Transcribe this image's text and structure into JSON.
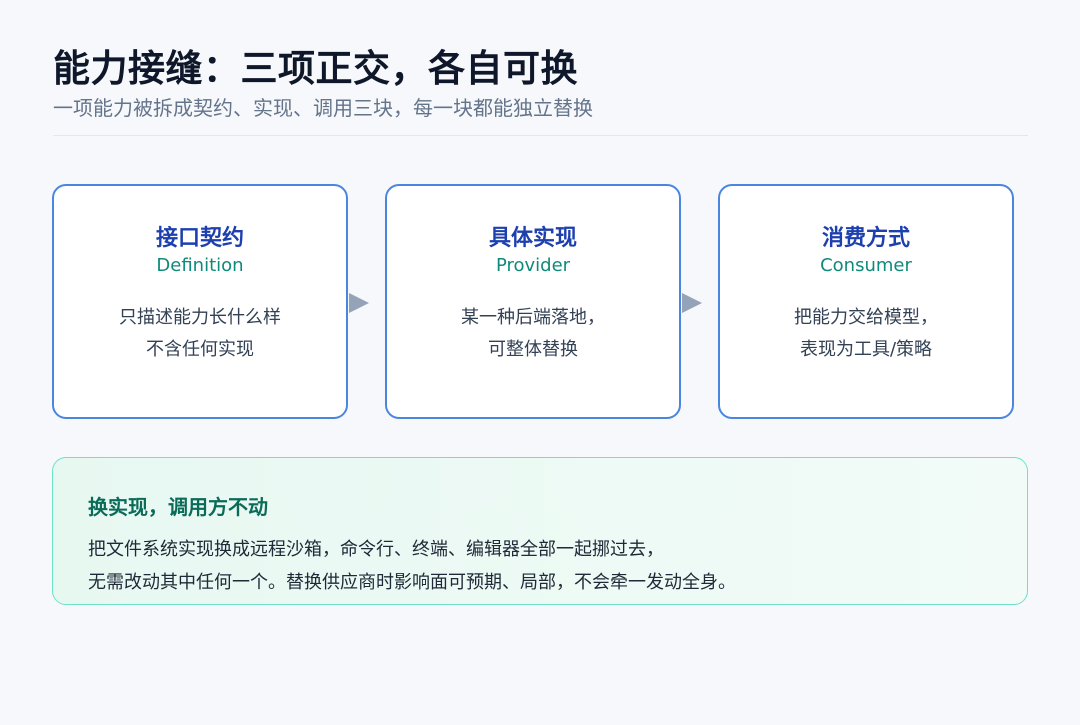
{
  "header": {
    "title": "能力接缝：三项正交，各自可换",
    "subtitle": "一项能力被拆成契约、实现、调用三块，每一块都能独立替换"
  },
  "cards": [
    {
      "title": "接口契约",
      "subtitle": "Definition",
      "lines": [
        "只描述能力长什么样",
        "不含任何实现"
      ]
    },
    {
      "title": "具体实现",
      "subtitle": "Provider",
      "lines": [
        "某一种后端落地，",
        "可整体替换"
      ]
    },
    {
      "title": "消费方式",
      "subtitle": "Consumer",
      "lines": [
        "把能力交给模型，",
        "表现为工具/策略"
      ]
    }
  ],
  "note": {
    "title": "换实现，调用方不动",
    "lines": [
      "把文件系统实现换成远程沙箱，命令行、终端、编辑器全部一起挪过去，",
      "无需改动其中任何一个。替换供应商时影响面可预期、局部，不会牵一发动全身。"
    ]
  },
  "colors": {
    "card_border": "#4a86e0",
    "card_title": "#1e40af",
    "card_subtitle": "#0f8a7a",
    "arrow": "#94a3b8",
    "note_border": "#6ee2c4",
    "note_title": "#0b6b59"
  }
}
